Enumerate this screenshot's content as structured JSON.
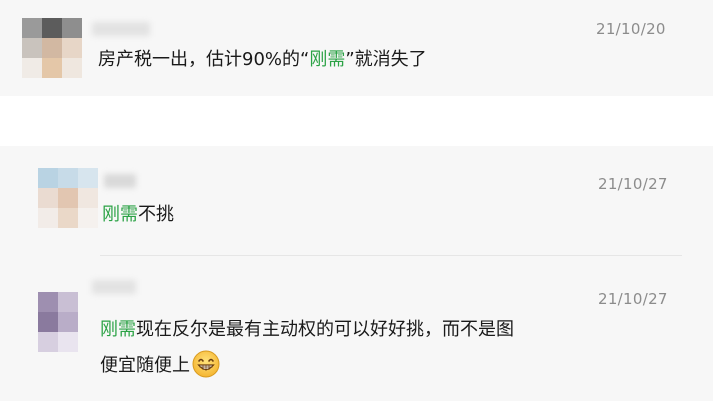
{
  "comments": [
    {
      "time": "21/10/20",
      "text_before": "房产税一出，估计90%的“",
      "keyword": "刚需",
      "text_after": "”就消失了"
    },
    {
      "time": "21/10/27",
      "keyword": "刚需",
      "text_after": "不挑"
    },
    {
      "time": "21/10/27",
      "keyword": "刚需",
      "line1_after": "现在反尔是最有主动权的可以好好挑，而不是图",
      "line2": "便宜随便上",
      "emoji_icon": "grinning-face-icon"
    }
  ],
  "colors": {
    "keyword": "#2ba245",
    "timestamp": "#8c8c8c",
    "card_background": "#f7f7f7"
  }
}
